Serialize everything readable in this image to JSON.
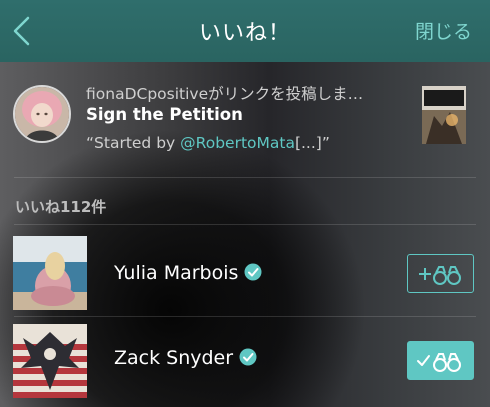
{
  "header": {
    "title": "いいね！",
    "close_label": "閉じる"
  },
  "post": {
    "line1": "fionaDCpositiveがリンクを投稿しま…",
    "title": "Sign the Petition",
    "quote_prefix": "“Started by ",
    "quote_mention": "@RobertoMata",
    "quote_suffix": "[...]”"
  },
  "likes": {
    "count_label": "いいね112件",
    "users": [
      {
        "name": "Yulia Marbois",
        "verified": true,
        "following": false
      },
      {
        "name": "Zack Snyder",
        "verified": true,
        "following": true
      }
    ]
  },
  "colors": {
    "nav_bg": "#2e6a6a",
    "accent": "#5fc7c3"
  }
}
